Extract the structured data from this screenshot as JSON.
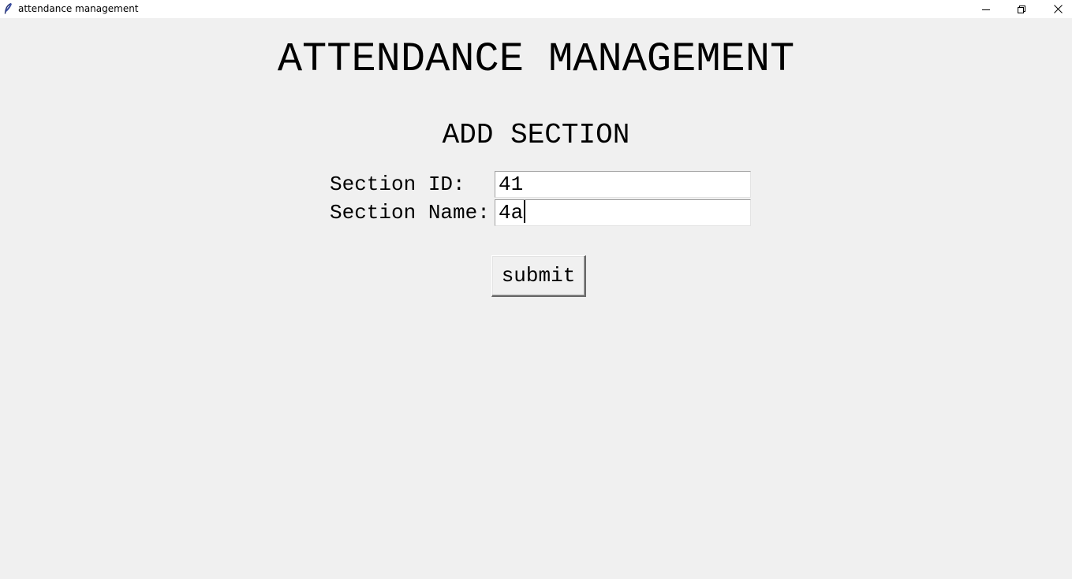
{
  "window": {
    "title": "attendance management",
    "icon": "feather-icon",
    "controls": [
      "minimize-icon",
      "restore-icon",
      "close-icon"
    ]
  },
  "main": {
    "title": "ATTENDANCE MANAGEMENT",
    "subtitle": "ADD SECTION"
  },
  "form": {
    "section_id_label": "Section ID:",
    "section_id_value": "41",
    "section_name_label": "Section Name:",
    "section_name_value": "4a",
    "submit_label": "submit"
  }
}
